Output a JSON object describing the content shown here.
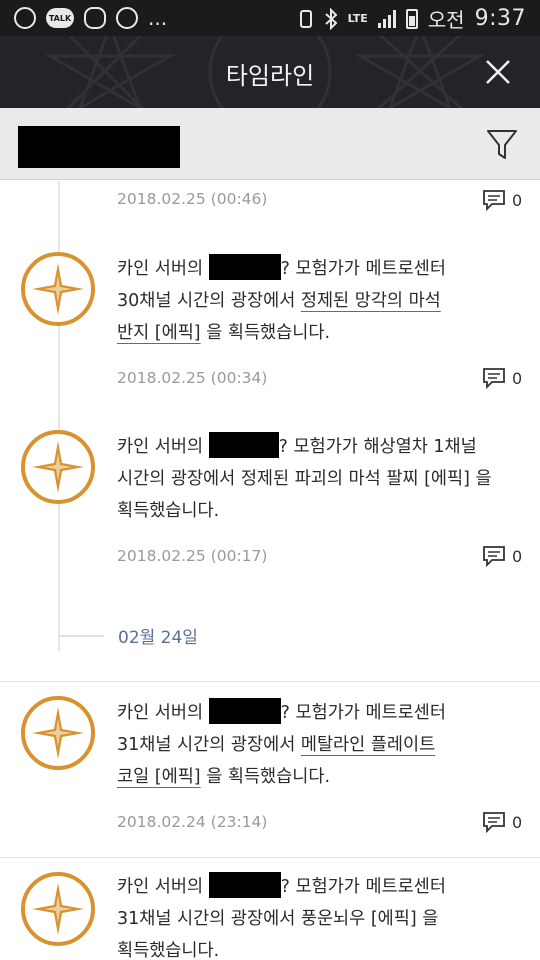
{
  "status_bar": {
    "talk_label": "TALK",
    "dots": "...",
    "lte": "LTE",
    "ampm": "오전",
    "time": "9:37"
  },
  "header": {
    "title": "타임라인"
  },
  "icons": {
    "close": "close-icon",
    "filter": "filter-icon",
    "comment": "comment-icon",
    "emblem": "compass-star-icon"
  },
  "colors": {
    "accent_orange": "#d8922e",
    "date_separator": "#5b6f95",
    "underline_red": "#e03333"
  },
  "timeline": {
    "entries": [
      {
        "date": "2018.02.25 (00:46)",
        "comments": "0"
      },
      {
        "line1_a": "카인 서버의 ",
        "line1_b": "? 모험가가 메트로센터",
        "line2_a": "30채널 시간의 광장에서 ",
        "line2_item": "정제된 망각의 마석",
        "line3_item": "반지 [에픽]",
        "line3_b": " 을 획득했습니다.",
        "date": "2018.02.25 (00:34)",
        "comments": "0"
      },
      {
        "line1_a": "카인 서버의 ",
        "line1_b": "? 모험가가 해상열차 1채널",
        "line2": "시간의 광장에서 정제된 파괴의 마석 팔찌 [에픽] 을",
        "line3": "획득했습니다.",
        "date": "2018.02.25 (00:17)",
        "comments": "0"
      }
    ],
    "separator": "02월 24일",
    "entries2": [
      {
        "line1_a": "카인 서버의 ",
        "line1_b": "? 모험가가 메트로센터",
        "line2_a": "31채널 시간의 광장에서 ",
        "line2_item": "메탈라인 플레이트",
        "line3_item": "코일 [에픽]",
        "line3_b": " 을 획득했습니다.",
        "date": "2018.02.24 (23:14)",
        "comments": "0"
      },
      {
        "line1_a": "카인 서버의 ",
        "line1_b": "? 모험가가 메트로센터",
        "line2": "31채널 시간의 광장에서 풍운뇌우 [에픽] 을",
        "line3": "획득했습니다."
      }
    ]
  }
}
